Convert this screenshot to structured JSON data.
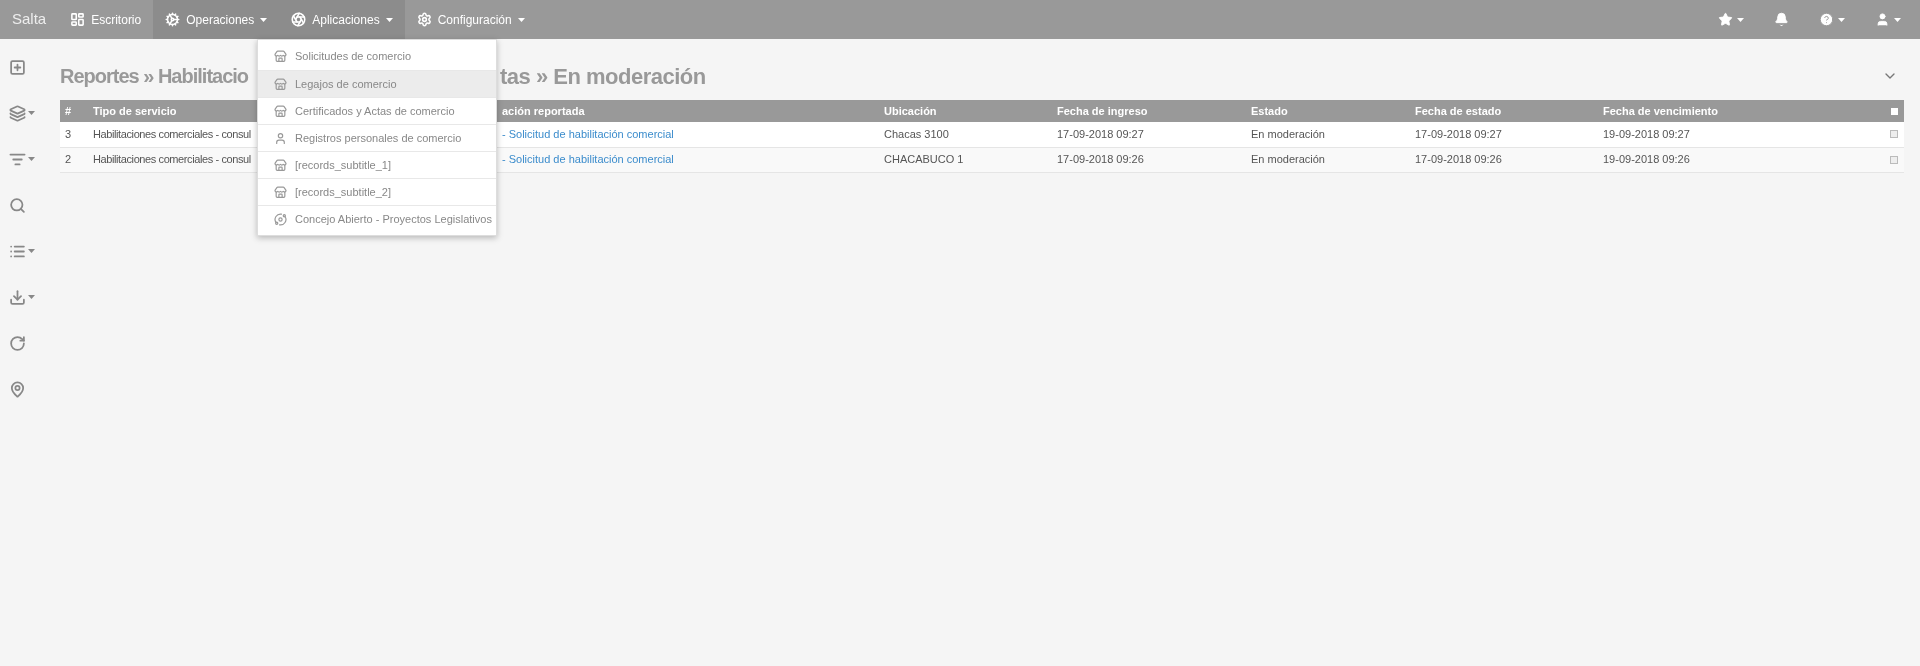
{
  "topbar": {
    "brand": "Salta",
    "menus": [
      {
        "label": "Escritorio",
        "caret": false,
        "active": false
      },
      {
        "label": "Operaciones",
        "caret": true,
        "active": true
      },
      {
        "label": "Aplicaciones",
        "caret": true,
        "active": true
      },
      {
        "label": "Configuración",
        "caret": true,
        "active": false
      }
    ],
    "right": [
      {
        "caret": true
      },
      {
        "caret": false
      },
      {
        "caret": true
      },
      {
        "caret": true
      }
    ]
  },
  "sidebar": [
    {
      "caret": false
    },
    {
      "caret": true
    },
    {
      "caret": true
    },
    {
      "caret": false
    },
    {
      "caret": true
    },
    {
      "caret": true
    },
    {
      "caret": false
    },
    {
      "caret": false
    }
  ],
  "title": {
    "part_1": "Reportes » Habilitacio",
    "part_2": "tas » En moderación"
  },
  "table": {
    "columns": [
      "#",
      "Tipo de servicio",
      "ación reportada",
      "Ubicación",
      "Fecha de ingreso",
      "Estado",
      "Fecha de estado",
      "Fecha de vencimiento"
    ],
    "select_all_checked": false,
    "rows": [
      {
        "cells": [
          "3",
          "Habilitaciones comerciales - consul",
          "- Solicitud de habilitación comercial",
          "Chacas 3100",
          "17-09-2018 09:27",
          "En moderación",
          "17-09-2018 09:27",
          "19-09-2018 09:27"
        ],
        "checked": false
      },
      {
        "cells": [
          "2",
          "Habilitaciones comerciales - consul",
          "- Solicitud de habilitación comercial",
          "CHACABUCO 1",
          "17-09-2018 09:26",
          "En moderación",
          "17-09-2018 09:26",
          "19-09-2018 09:26"
        ],
        "checked": false
      }
    ]
  },
  "dropdown": [
    {
      "label": "Solicitudes de comercio",
      "kind": "store",
      "selected": false
    },
    {
      "label": "Legajos de comercio",
      "kind": "store",
      "selected": true
    },
    {
      "label": "Certificados y Actas de comercio",
      "kind": "store",
      "selected": false
    },
    {
      "label": "Registros personales de comercio",
      "kind": "person",
      "selected": false
    },
    {
      "label": "[records_subtitle_1]",
      "kind": "store",
      "selected": false
    },
    {
      "label": "[records_subtitle_2]",
      "kind": "store",
      "selected": false
    },
    {
      "label": "Concejo Abierto - Proyectos Legislativos",
      "kind": "dots",
      "selected": false
    }
  ]
}
